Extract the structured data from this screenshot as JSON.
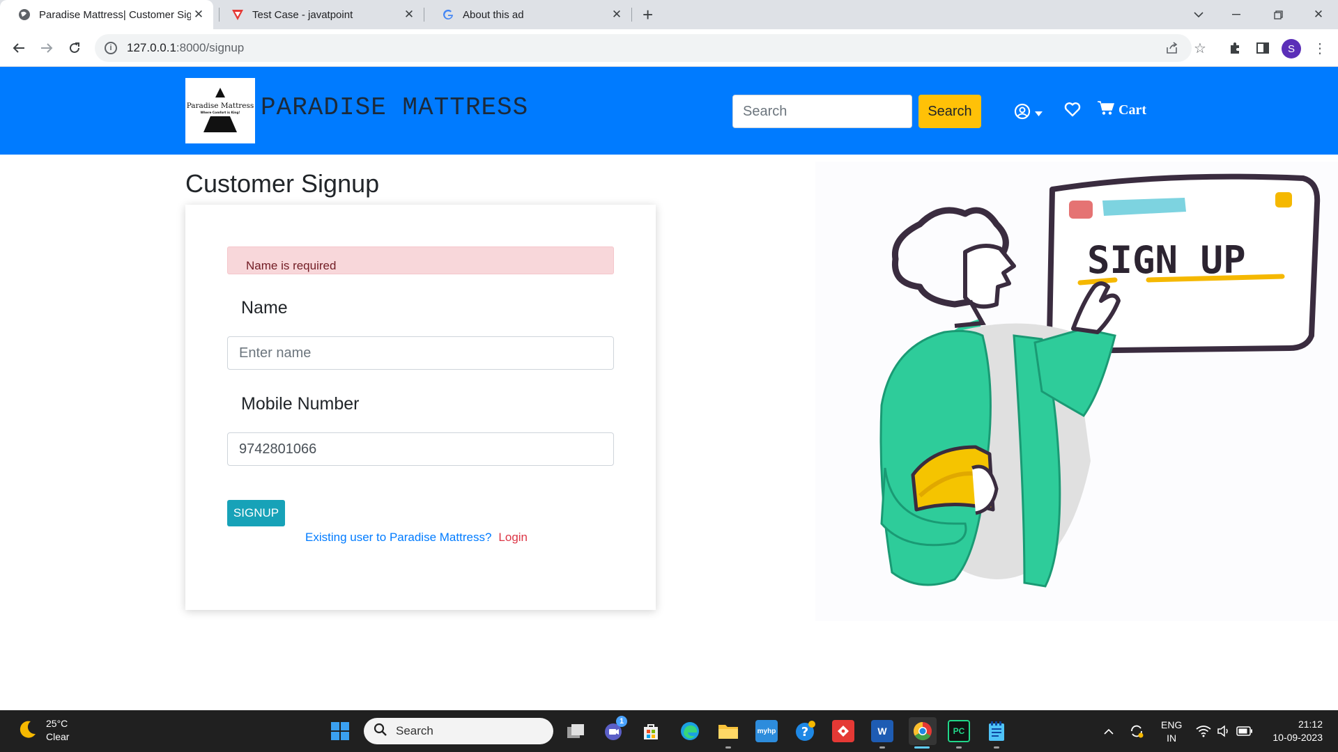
{
  "browser": {
    "tabs": [
      {
        "title": "Paradise Mattress| Customer Signup",
        "icon": "globe-icon",
        "active": true
      },
      {
        "title": "Test Case - javatpoint",
        "icon": "javatpoint-icon",
        "active": false
      },
      {
        "title": "About this ad",
        "icon": "google-icon",
        "active": false
      }
    ],
    "url_host": "127.0.0.1",
    "url_rest": ":8000/signup",
    "profile_initial": "S"
  },
  "site": {
    "logo_name": "Paradise Mattress",
    "logo_tagline": "Where Comfort is King!",
    "brand": "PARADISE MATTRESS",
    "search_placeholder": "Search",
    "search_button": "Search",
    "cart_label": "Cart",
    "nav_color": "#007bff"
  },
  "signup": {
    "title": "Customer Signup",
    "alert": "Name is required",
    "name_label": "Name",
    "name_placeholder": "Enter name",
    "mobile_label": "Mobile Number",
    "mobile_value": "9742801066",
    "submit": "SIGNUP",
    "existing_text": "Existing user to Paradise Mattress?",
    "login_link": "Login"
  },
  "illustration": {
    "board_text": "SIGN UP"
  },
  "taskbar": {
    "temperature": "25°C",
    "condition": "Clear",
    "search_label": "Search",
    "lang_line1": "ENG",
    "lang_line2": "IN",
    "time": "21:12",
    "date": "10-09-2023",
    "teams_badge": "1"
  }
}
